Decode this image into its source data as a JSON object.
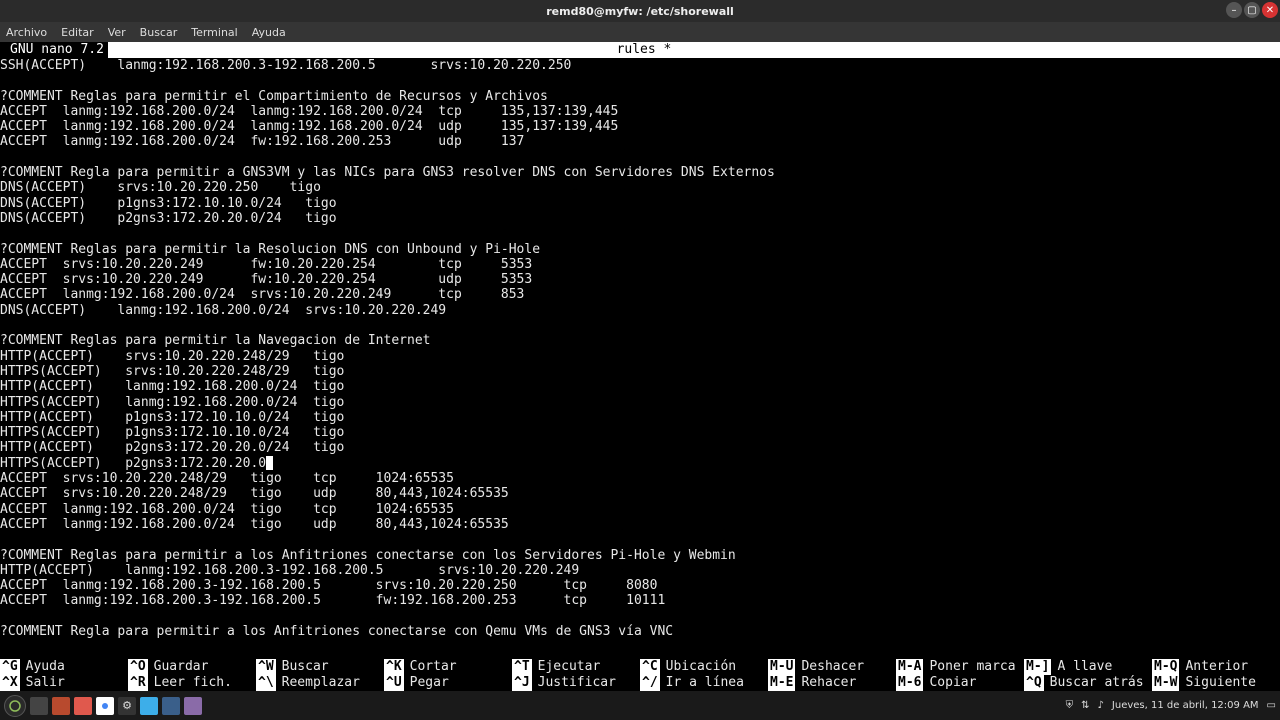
{
  "window": {
    "title": "remd80@myfw: /etc/shorewall"
  },
  "menu": [
    "Archivo",
    "Editar",
    "Ver",
    "Buscar",
    "Terminal",
    "Ayuda"
  ],
  "nano": {
    "name": "  GNU nano 7.2",
    "file": "rules *"
  },
  "lines": [
    "SSH(ACCEPT)    lanmg:192.168.200.3-192.168.200.5       srvs:10.20.220.250",
    "",
    "?COMMENT Reglas para permitir el Compartimiento de Recursos y Archivos",
    "ACCEPT  lanmg:192.168.200.0/24  lanmg:192.168.200.0/24  tcp     135,137:139,445",
    "ACCEPT  lanmg:192.168.200.0/24  lanmg:192.168.200.0/24  udp     135,137:139,445",
    "ACCEPT  lanmg:192.168.200.0/24  fw:192.168.200.253      udp     137",
    "",
    "?COMMENT Regla para permitir a GNS3VM y las NICs para GNS3 resolver DNS con Servidores DNS Externos",
    "DNS(ACCEPT)    srvs:10.20.220.250    tigo",
    "DNS(ACCEPT)    p1gns3:172.10.10.0/24   tigo",
    "DNS(ACCEPT)    p2gns3:172.20.20.0/24   tigo",
    "",
    "?COMMENT Reglas para permitir la Resolucion DNS con Unbound y Pi-Hole",
    "ACCEPT  srvs:10.20.220.249      fw:10.20.220.254        tcp     5353",
    "ACCEPT  srvs:10.20.220.249      fw:10.20.220.254        udp     5353",
    "ACCEPT  lanmg:192.168.200.0/24  srvs:10.20.220.249      tcp     853",
    "DNS(ACCEPT)    lanmg:192.168.200.0/24  srvs:10.20.220.249",
    "",
    "?COMMENT Reglas para permitir la Navegacion de Internet",
    "HTTP(ACCEPT)    srvs:10.20.220.248/29   tigo",
    "HTTPS(ACCEPT)   srvs:10.20.220.248/29   tigo",
    "HTTP(ACCEPT)    lanmg:192.168.200.0/24  tigo",
    "HTTPS(ACCEPT)   lanmg:192.168.200.0/24  tigo",
    "HTTP(ACCEPT)    p1gns3:172.10.10.0/24   tigo",
    "HTTPS(ACCEPT)   p1gns3:172.10.10.0/24   tigo",
    "HTTP(ACCEPT)    p2gns3:172.20.20.0/24   tigo",
    "HTTPS(ACCEPT)   p2gns3:172.20.20.0",
    "ACCEPT  srvs:10.20.220.248/29   tigo    tcp     1024:65535",
    "ACCEPT  srvs:10.20.220.248/29   tigo    udp     80,443,1024:65535",
    "ACCEPT  lanmg:192.168.200.0/24  tigo    tcp     1024:65535",
    "ACCEPT  lanmg:192.168.200.0/24  tigo    udp     80,443,1024:65535",
    "",
    "?COMMENT Reglas para permitir a los Anfitriones conectarse con los Servidores Pi-Hole y Webmin",
    "HTTP(ACCEPT)    lanmg:192.168.200.3-192.168.200.5       srvs:10.20.220.249",
    "ACCEPT  lanmg:192.168.200.3-192.168.200.5       srvs:10.20.220.250      tcp     8080",
    "ACCEPT  lanmg:192.168.200.3-192.168.200.5       fw:192.168.200.253      tcp     10111",
    "",
    "?COMMENT Regla para permitir a los Anfitriones conectarse con Qemu VMs de GNS3 vía VNC"
  ],
  "cursor_line": 26,
  "shortcuts_row1": [
    {
      "k": "^G",
      "l": "Ayuda"
    },
    {
      "k": "^O",
      "l": "Guardar"
    },
    {
      "k": "^W",
      "l": "Buscar"
    },
    {
      "k": "^K",
      "l": "Cortar"
    },
    {
      "k": "^T",
      "l": "Ejecutar"
    },
    {
      "k": "^C",
      "l": "Ubicación"
    },
    {
      "k": "M-U",
      "l": "Deshacer"
    },
    {
      "k": "M-A",
      "l": "Poner marca"
    },
    {
      "k": "M-]",
      "l": "A llave"
    },
    {
      "k": "M-Q",
      "l": "Anterior"
    }
  ],
  "shortcuts_row2": [
    {
      "k": "^X",
      "l": "Salir"
    },
    {
      "k": "^R",
      "l": "Leer fich."
    },
    {
      "k": "^\\",
      "l": "Reemplazar"
    },
    {
      "k": "^U",
      "l": "Pegar"
    },
    {
      "k": "^J",
      "l": "Justificar"
    },
    {
      "k": "^/",
      "l": "Ir a línea"
    },
    {
      "k": "M-E",
      "l": "Rehacer"
    },
    {
      "k": "M-6",
      "l": "Copiar"
    },
    {
      "k": "^Q",
      "l": "Buscar atrás"
    },
    {
      "k": "M-W",
      "l": "Siguiente"
    }
  ],
  "datetime": "Jueves, 11 de abril, 12:09 AM"
}
